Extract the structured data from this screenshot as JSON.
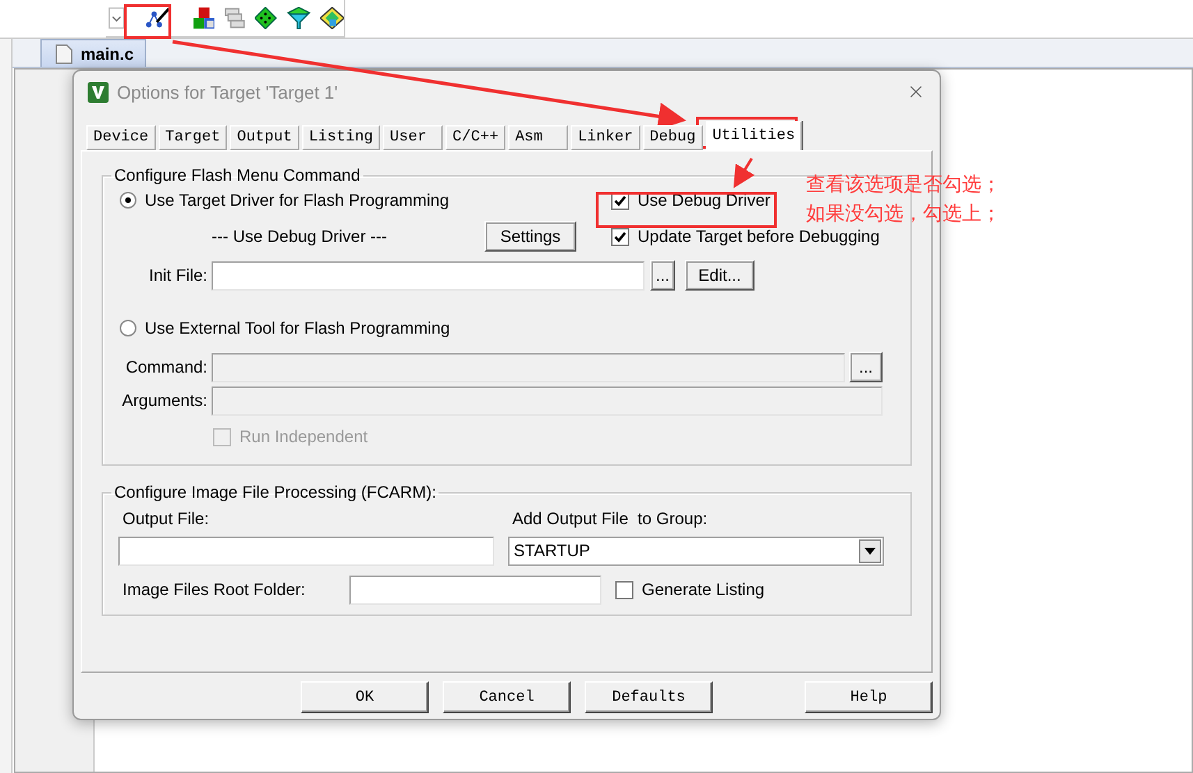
{
  "editor_tab": "main.c",
  "dialog": {
    "title": "Options for Target 'Target 1'",
    "tabs": [
      {
        "label": "Device",
        "selected": false
      },
      {
        "label": "Target",
        "selected": false
      },
      {
        "label": "Output",
        "selected": false
      },
      {
        "label": "Listing",
        "selected": false
      },
      {
        "label": "User",
        "selected": false
      },
      {
        "label": "C/C++",
        "selected": false
      },
      {
        "label": "Asm",
        "selected": false
      },
      {
        "label": "Linker",
        "selected": false
      },
      {
        "label": "Debug",
        "selected": false
      },
      {
        "label": "Utilities",
        "selected": true
      }
    ],
    "flash_group": {
      "title": "Configure Flash Menu Command",
      "target_driver": {
        "label": "Use Target Driver for Flash Programming",
        "selected": true
      },
      "use_debug_driver": {
        "label": "Use Debug Driver",
        "checked": true
      },
      "driver_note": "--- Use Debug Driver ---",
      "settings_button": "Settings",
      "update_target": {
        "label": "Update Target before Debugging",
        "checked": true
      },
      "init_file_label": "Init File:",
      "init_browse_button": "...",
      "edit_button": "Edit...",
      "external_tool": {
        "label": "Use External Tool for Flash Programming",
        "selected": false
      },
      "command_label": "Command:",
      "command_field": {
        "disabled": true
      },
      "command_browse_button": "...",
      "arguments_label": "Arguments:",
      "arguments_field": {
        "disabled": true
      },
      "run_independent": {
        "label": "Run Independent",
        "checked": false,
        "disabled": true
      }
    },
    "image_group": {
      "title": "Configure Image File Processing (FCARM):",
      "output_file_label": "Output File:",
      "group_label": "Add Output File  to Group:",
      "group_value": "STARTUP",
      "root_folder_label": "Image Files Root Folder:",
      "generate_listing": {
        "label": "Generate Listing",
        "checked": false
      }
    },
    "buttons": [
      "OK",
      "Cancel",
      "Defaults",
      "Help"
    ]
  },
  "annotation": {
    "lines": [
      "查看该选项是否勾选；",
      "如果没勾选，勾选上；"
    ]
  }
}
